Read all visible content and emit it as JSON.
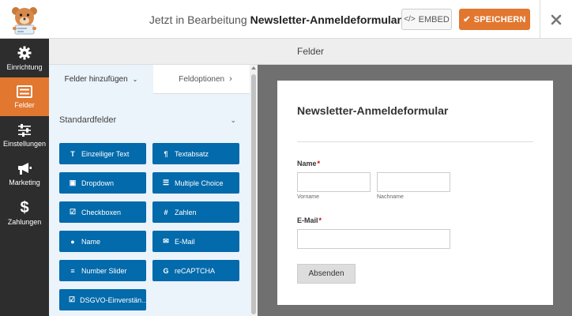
{
  "header": {
    "editing_prefix": "Jetzt in Bearbeitung",
    "form_name": "Newsletter-Anmeldeformular",
    "embed_label": "EMBED",
    "save_label": "SPEICHERN",
    "close_icon": "×",
    "accent_color": "#e27730"
  },
  "nav": {
    "items": [
      {
        "label": "Einrichtung",
        "icon": "gear-icon"
      },
      {
        "label": "Felder",
        "icon": "fields-icon",
        "active": true
      },
      {
        "label": "Einstellungen",
        "icon": "sliders-icon"
      },
      {
        "label": "Marketing",
        "icon": "megaphone-icon"
      },
      {
        "label": "Zahlungen",
        "icon": "dollar-icon"
      }
    ]
  },
  "section_title": "Felder",
  "panel": {
    "tab_add": "Felder hinzufügen",
    "tab_options": "Feldoptionen",
    "group_title": "Standardfelder",
    "fields": [
      {
        "label": "Einzeiliger Text",
        "icon": "T"
      },
      {
        "label": "Textabsatz",
        "icon": "¶"
      },
      {
        "label": "Dropdown",
        "icon": "▣"
      },
      {
        "label": "Multiple Choice",
        "icon": "☰"
      },
      {
        "label": "Checkboxen",
        "icon": "☑"
      },
      {
        "label": "Zahlen",
        "icon": "#"
      },
      {
        "label": "Name",
        "icon": "●"
      },
      {
        "label": "E-Mail",
        "icon": "✉"
      },
      {
        "label": "Number Slider",
        "icon": "≡"
      },
      {
        "label": "reCAPTCHA",
        "icon": "G"
      },
      {
        "label": "DSGVO-Einverstän…",
        "icon": "☑"
      }
    ]
  },
  "preview": {
    "title": "Newsletter-Anmeldeformular",
    "name_label": "Name",
    "first_name_sub": "Vorname",
    "last_name_sub": "Nachname",
    "email_label": "E-Mail",
    "required_mark": "*",
    "submit_label": "Absenden"
  }
}
